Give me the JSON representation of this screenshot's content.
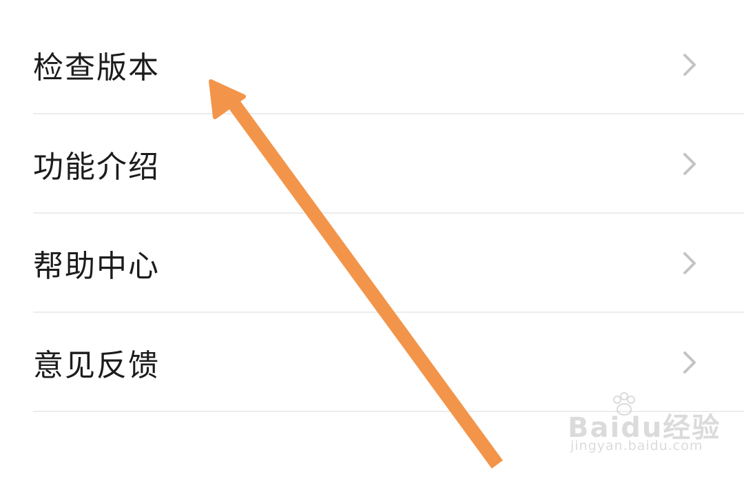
{
  "menu": {
    "items": [
      {
        "label": "检查版本",
        "icon": "chevron-right-icon"
      },
      {
        "label": "功能介绍",
        "icon": "chevron-right-icon"
      },
      {
        "label": "帮助中心",
        "icon": "chevron-right-icon"
      },
      {
        "label": "意见反馈",
        "icon": "chevron-right-icon"
      }
    ]
  },
  "annotation": {
    "icon": "arrow-icon",
    "color": "#f2954a"
  },
  "watermark": {
    "brand": "Baidu经验",
    "url": "jingyan.baidu.com"
  },
  "colors": {
    "text": "#1c1c1c",
    "chevron": "#c4c4c4",
    "divider": "#ececec",
    "background": "#ffffff"
  }
}
